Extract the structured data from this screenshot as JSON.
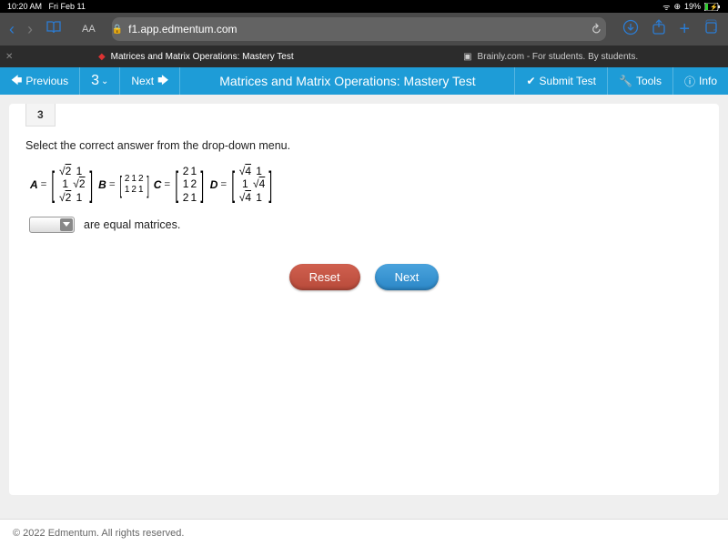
{
  "status": {
    "time": "10:20 AM",
    "date": "Fri Feb 11",
    "battery": "19%"
  },
  "browser": {
    "aa": "AA",
    "url": "f1.app.edmentum.com"
  },
  "tabs": {
    "left": "Matrices and Matrix Operations: Mastery Test",
    "right": "Brainly.com - For students. By students."
  },
  "appbar": {
    "previous": "Previous",
    "questionNum": "3",
    "next": "Next",
    "title": "Matrices and Matrix Operations: Mastery Test",
    "submit": "Submit Test",
    "tools": "Tools",
    "info": "Info"
  },
  "question": {
    "number": "3",
    "instruction": "Select the correct answer from the drop-down menu.",
    "answerText": "are equal matrices."
  },
  "matrices": {
    "A": {
      "label": "A",
      "rows": [
        [
          "√2",
          "1"
        ],
        [
          "1",
          "√2"
        ],
        [
          "√2",
          "1"
        ]
      ]
    },
    "B": {
      "label": "B",
      "rows": [
        [
          "2",
          "1",
          "2"
        ],
        [
          "1",
          "2",
          "1"
        ]
      ]
    },
    "C": {
      "label": "C",
      "rows": [
        [
          "2",
          "1"
        ],
        [
          "1",
          "2"
        ],
        [
          "2",
          "1"
        ]
      ]
    },
    "D": {
      "label": "D",
      "rows": [
        [
          "√4",
          "1"
        ],
        [
          "1",
          "√4"
        ],
        [
          "√4",
          "1"
        ]
      ]
    }
  },
  "buttons": {
    "reset": "Reset",
    "next": "Next"
  },
  "footer": {
    "copyright": "© 2022 Edmentum. All rights reserved."
  }
}
